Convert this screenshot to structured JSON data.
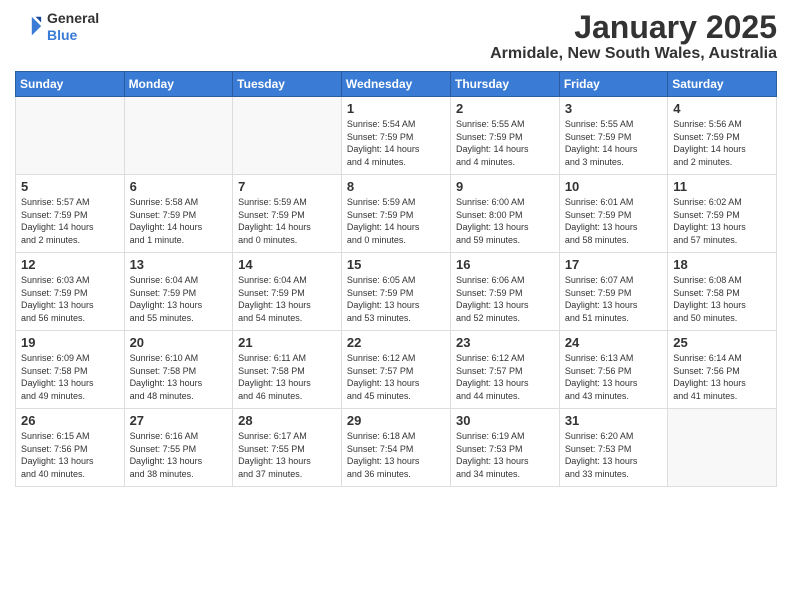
{
  "header": {
    "logo_general": "General",
    "logo_blue": "Blue",
    "month": "January 2025",
    "location": "Armidale, New South Wales, Australia"
  },
  "weekdays": [
    "Sunday",
    "Monday",
    "Tuesday",
    "Wednesday",
    "Thursday",
    "Friday",
    "Saturday"
  ],
  "weeks": [
    [
      {
        "day": "",
        "info": ""
      },
      {
        "day": "",
        "info": ""
      },
      {
        "day": "",
        "info": ""
      },
      {
        "day": "1",
        "info": "Sunrise: 5:54 AM\nSunset: 7:59 PM\nDaylight: 14 hours\nand 4 minutes."
      },
      {
        "day": "2",
        "info": "Sunrise: 5:55 AM\nSunset: 7:59 PM\nDaylight: 14 hours\nand 4 minutes."
      },
      {
        "day": "3",
        "info": "Sunrise: 5:55 AM\nSunset: 7:59 PM\nDaylight: 14 hours\nand 3 minutes."
      },
      {
        "day": "4",
        "info": "Sunrise: 5:56 AM\nSunset: 7:59 PM\nDaylight: 14 hours\nand 2 minutes."
      }
    ],
    [
      {
        "day": "5",
        "info": "Sunrise: 5:57 AM\nSunset: 7:59 PM\nDaylight: 14 hours\nand 2 minutes."
      },
      {
        "day": "6",
        "info": "Sunrise: 5:58 AM\nSunset: 7:59 PM\nDaylight: 14 hours\nand 1 minute."
      },
      {
        "day": "7",
        "info": "Sunrise: 5:59 AM\nSunset: 7:59 PM\nDaylight: 14 hours\nand 0 minutes."
      },
      {
        "day": "8",
        "info": "Sunrise: 5:59 AM\nSunset: 7:59 PM\nDaylight: 14 hours\nand 0 minutes."
      },
      {
        "day": "9",
        "info": "Sunrise: 6:00 AM\nSunset: 8:00 PM\nDaylight: 13 hours\nand 59 minutes."
      },
      {
        "day": "10",
        "info": "Sunrise: 6:01 AM\nSunset: 7:59 PM\nDaylight: 13 hours\nand 58 minutes."
      },
      {
        "day": "11",
        "info": "Sunrise: 6:02 AM\nSunset: 7:59 PM\nDaylight: 13 hours\nand 57 minutes."
      }
    ],
    [
      {
        "day": "12",
        "info": "Sunrise: 6:03 AM\nSunset: 7:59 PM\nDaylight: 13 hours\nand 56 minutes."
      },
      {
        "day": "13",
        "info": "Sunrise: 6:04 AM\nSunset: 7:59 PM\nDaylight: 13 hours\nand 55 minutes."
      },
      {
        "day": "14",
        "info": "Sunrise: 6:04 AM\nSunset: 7:59 PM\nDaylight: 13 hours\nand 54 minutes."
      },
      {
        "day": "15",
        "info": "Sunrise: 6:05 AM\nSunset: 7:59 PM\nDaylight: 13 hours\nand 53 minutes."
      },
      {
        "day": "16",
        "info": "Sunrise: 6:06 AM\nSunset: 7:59 PM\nDaylight: 13 hours\nand 52 minutes."
      },
      {
        "day": "17",
        "info": "Sunrise: 6:07 AM\nSunset: 7:59 PM\nDaylight: 13 hours\nand 51 minutes."
      },
      {
        "day": "18",
        "info": "Sunrise: 6:08 AM\nSunset: 7:58 PM\nDaylight: 13 hours\nand 50 minutes."
      }
    ],
    [
      {
        "day": "19",
        "info": "Sunrise: 6:09 AM\nSunset: 7:58 PM\nDaylight: 13 hours\nand 49 minutes."
      },
      {
        "day": "20",
        "info": "Sunrise: 6:10 AM\nSunset: 7:58 PM\nDaylight: 13 hours\nand 48 minutes."
      },
      {
        "day": "21",
        "info": "Sunrise: 6:11 AM\nSunset: 7:58 PM\nDaylight: 13 hours\nand 46 minutes."
      },
      {
        "day": "22",
        "info": "Sunrise: 6:12 AM\nSunset: 7:57 PM\nDaylight: 13 hours\nand 45 minutes."
      },
      {
        "day": "23",
        "info": "Sunrise: 6:12 AM\nSunset: 7:57 PM\nDaylight: 13 hours\nand 44 minutes."
      },
      {
        "day": "24",
        "info": "Sunrise: 6:13 AM\nSunset: 7:56 PM\nDaylight: 13 hours\nand 43 minutes."
      },
      {
        "day": "25",
        "info": "Sunrise: 6:14 AM\nSunset: 7:56 PM\nDaylight: 13 hours\nand 41 minutes."
      }
    ],
    [
      {
        "day": "26",
        "info": "Sunrise: 6:15 AM\nSunset: 7:56 PM\nDaylight: 13 hours\nand 40 minutes."
      },
      {
        "day": "27",
        "info": "Sunrise: 6:16 AM\nSunset: 7:55 PM\nDaylight: 13 hours\nand 38 minutes."
      },
      {
        "day": "28",
        "info": "Sunrise: 6:17 AM\nSunset: 7:55 PM\nDaylight: 13 hours\nand 37 minutes."
      },
      {
        "day": "29",
        "info": "Sunrise: 6:18 AM\nSunset: 7:54 PM\nDaylight: 13 hours\nand 36 minutes."
      },
      {
        "day": "30",
        "info": "Sunrise: 6:19 AM\nSunset: 7:53 PM\nDaylight: 13 hours\nand 34 minutes."
      },
      {
        "day": "31",
        "info": "Sunrise: 6:20 AM\nSunset: 7:53 PM\nDaylight: 13 hours\nand 33 minutes."
      },
      {
        "day": "",
        "info": ""
      }
    ]
  ]
}
